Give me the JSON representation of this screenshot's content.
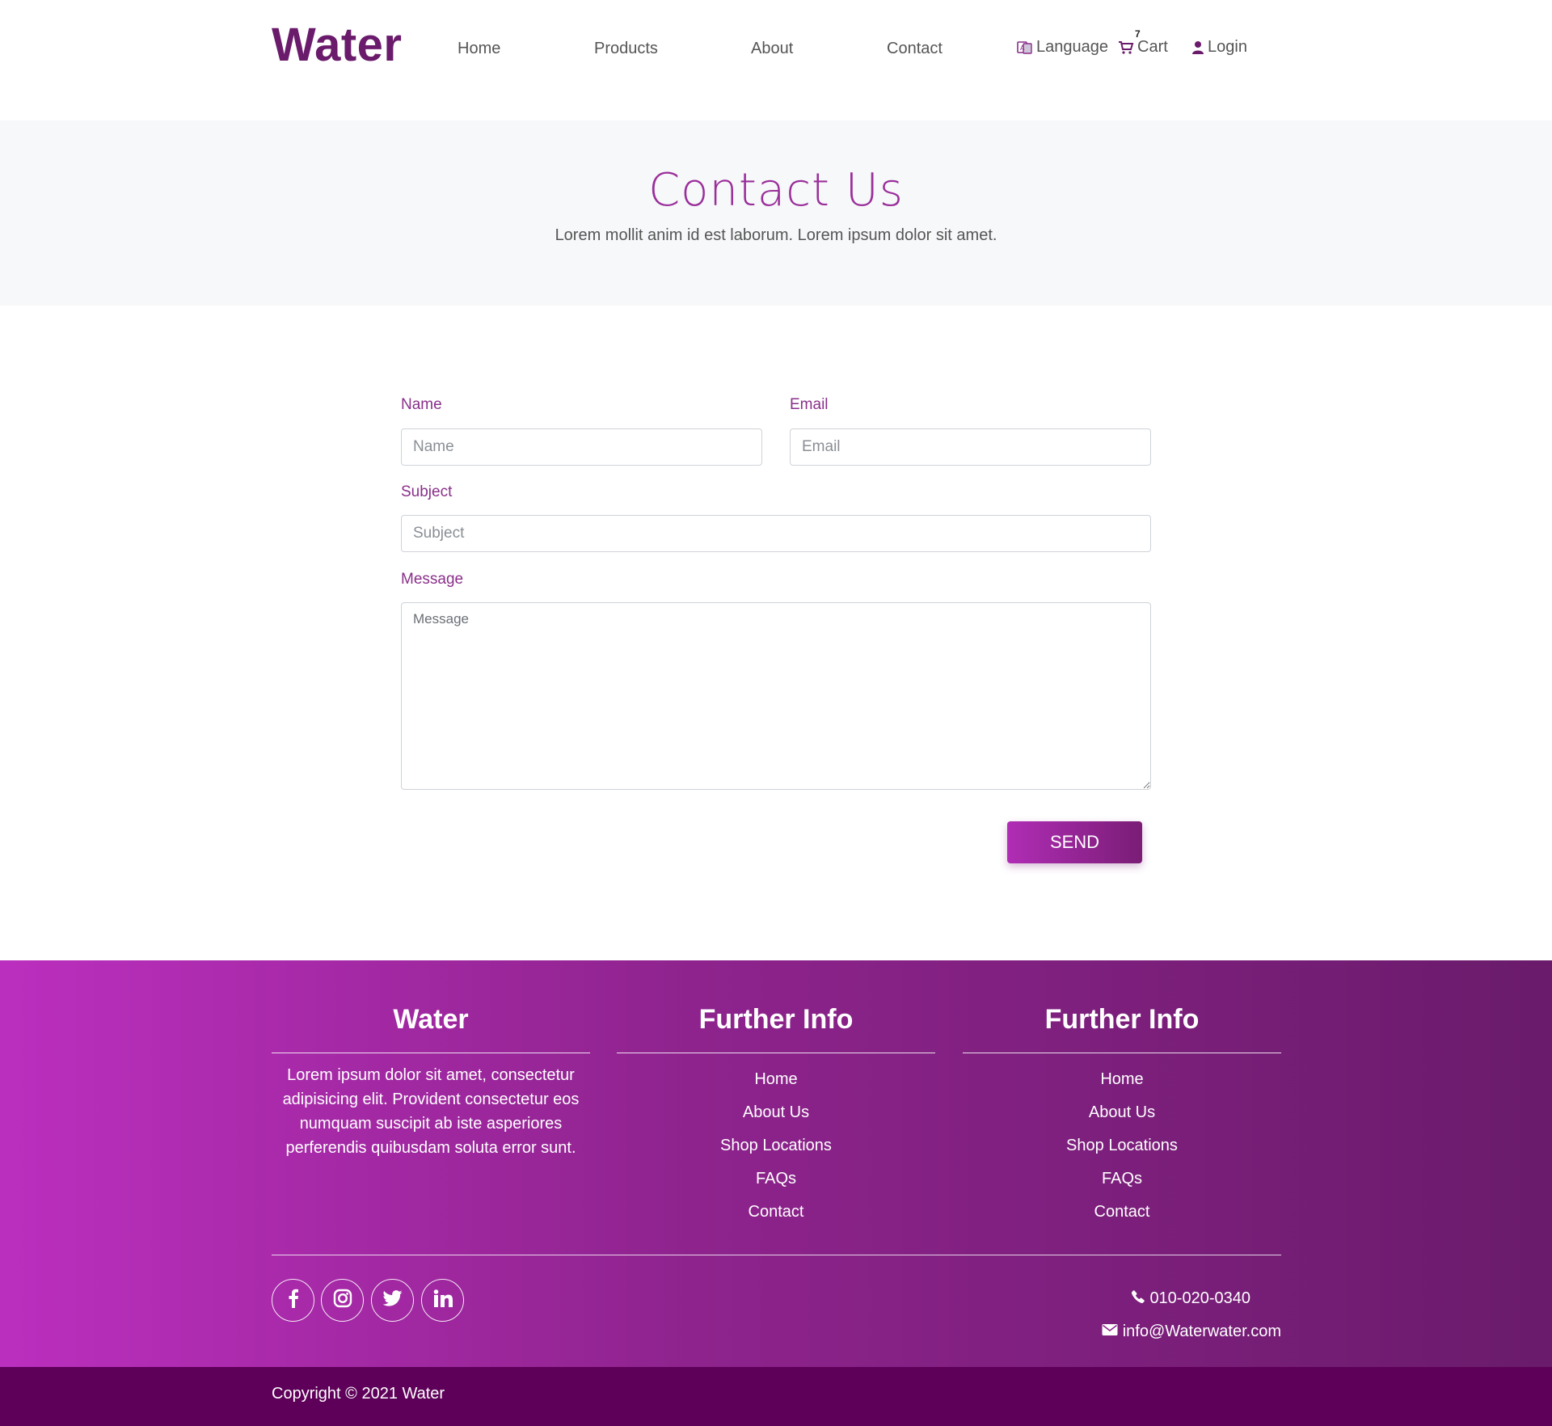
{
  "brand": {
    "name": "Water",
    "color": "#6a1b6b"
  },
  "nav": {
    "items": [
      {
        "label": "Home"
      },
      {
        "label": "Products"
      },
      {
        "label": "About"
      },
      {
        "label": "Contact"
      }
    ],
    "language_label": "Language",
    "cart_label": "Cart",
    "cart_count": "7",
    "login_label": "Login",
    "icons": [
      "language-icon",
      "cart-icon",
      "user-icon"
    ]
  },
  "hero": {
    "title": "Contact Us",
    "subtitle": "Lorem mollit anim id est laborum. Lorem ipsum dolor sit amet."
  },
  "form": {
    "name_label": "Name",
    "name_placeholder": "Name",
    "email_label": "Email",
    "email_placeholder": "Email",
    "subject_label": "Subject",
    "subject_placeholder": "Subject",
    "message_label": "Message",
    "message_placeholder": "Message",
    "send_label": "SEND"
  },
  "footer": {
    "columns": [
      {
        "title": "Water",
        "text": "Lorem ipsum dolor sit amet, consectetur adipisicing elit. Provident consectetur eos numquam suscipit ab iste asperiores perferendis quibusdam soluta error sunt."
      },
      {
        "title": "Further Info",
        "links": [
          "Home",
          "About Us",
          "Shop Locations",
          "FAQs",
          "Contact"
        ]
      },
      {
        "title": "Further Info",
        "links": [
          "Home",
          "About Us",
          "Shop Locations",
          "FAQs",
          "Contact"
        ]
      }
    ],
    "social_icons": [
      "facebook-icon",
      "instagram-icon",
      "twitter-icon",
      "linkedin-icon"
    ],
    "phone": "010-020-0340",
    "email": "info@Waterwater.com",
    "copyright": "Copyright © 2021 Water"
  },
  "colors": {
    "accent": "#9a2f9a",
    "footer_gradient_start": "#bb2fbe",
    "footer_gradient_end": "#6a1b6b",
    "copyright_bg": "#5e0059",
    "hero_bg": "#f7f8fa"
  }
}
